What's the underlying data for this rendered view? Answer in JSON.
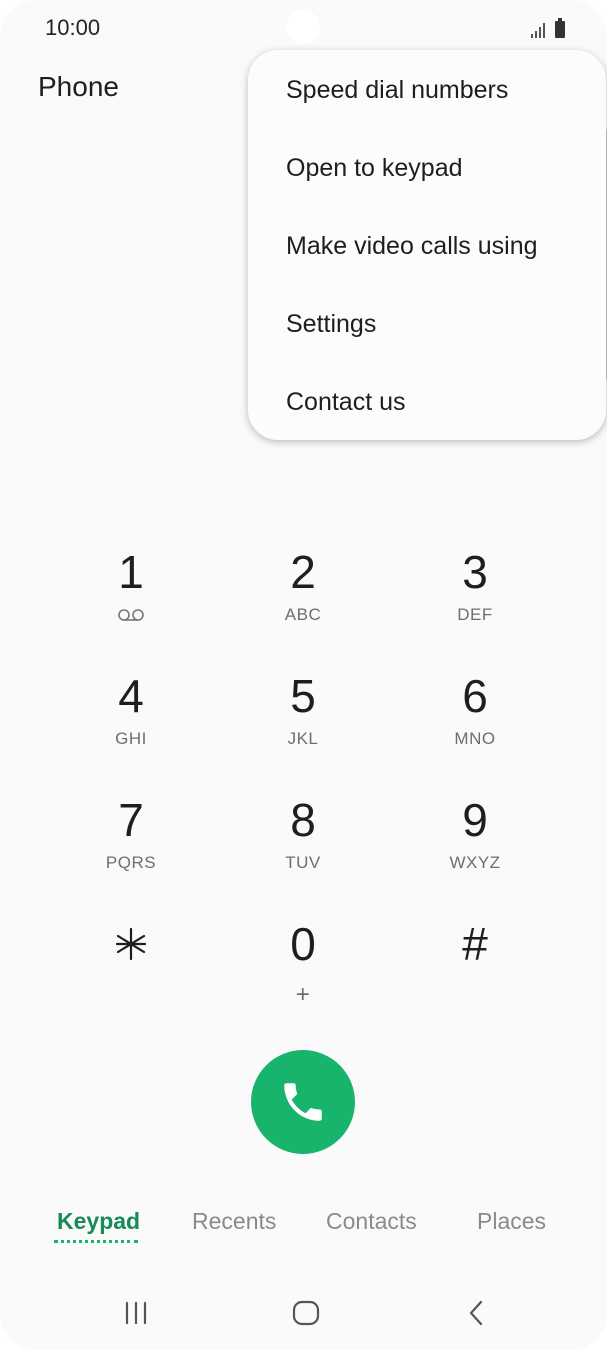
{
  "status_bar": {
    "time": "10:00",
    "signal_icon": "signal-icon",
    "battery_icon": "battery-icon"
  },
  "header": {
    "title": "Phone"
  },
  "menu": {
    "items": [
      {
        "label": "Speed dial numbers"
      },
      {
        "label": "Open to keypad"
      },
      {
        "label": "Make video calls using"
      },
      {
        "label": "Settings"
      },
      {
        "label": "Contact us"
      }
    ]
  },
  "keypad": {
    "keys": [
      {
        "digit": "1",
        "letters": "",
        "icon": "voicemail-icon"
      },
      {
        "digit": "2",
        "letters": "ABC"
      },
      {
        "digit": "3",
        "letters": "DEF"
      },
      {
        "digit": "4",
        "letters": "GHI"
      },
      {
        "digit": "5",
        "letters": "JKL"
      },
      {
        "digit": "6",
        "letters": "MNO"
      },
      {
        "digit": "7",
        "letters": "PQRS"
      },
      {
        "digit": "8",
        "letters": "TUV"
      },
      {
        "digit": "9",
        "letters": "WXYZ"
      },
      {
        "digit": "⁎",
        "letters": ""
      },
      {
        "digit": "0",
        "letters": "+"
      },
      {
        "digit": "#",
        "letters": ""
      }
    ],
    "call_icon": "phone-icon",
    "call_color": "#19b46c"
  },
  "tabs": [
    {
      "label": "Keypad",
      "active": true
    },
    {
      "label": "Recents",
      "active": false
    },
    {
      "label": "Contacts",
      "active": false
    },
    {
      "label": "Places",
      "active": false
    }
  ],
  "colors": {
    "accent": "#19b46c",
    "active_tab": "#168a57"
  },
  "nav": {
    "recents_icon": "recent-apps-icon",
    "home_icon": "home-icon",
    "back_icon": "back-icon"
  }
}
